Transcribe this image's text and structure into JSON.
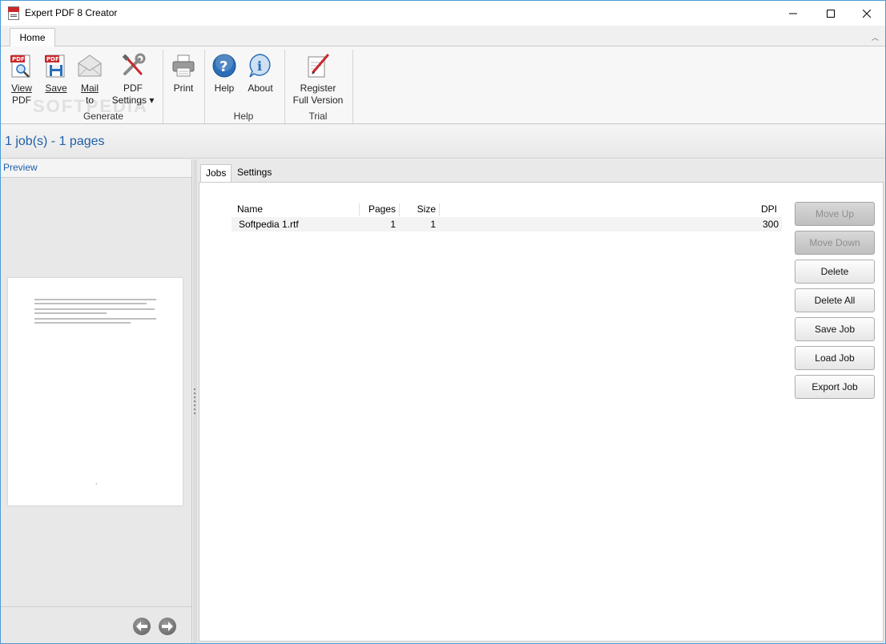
{
  "window": {
    "title": "Expert PDF 8 Creator"
  },
  "ribbon": {
    "tab_home": "Home",
    "buttons": {
      "view_pdf": [
        "View",
        "PDF"
      ],
      "save": "Save",
      "mail_to": [
        "Mail",
        "to"
      ],
      "pdf_settings": [
        "PDF",
        "Settings ▾"
      ],
      "print": "Print",
      "help": "Help",
      "about": "About",
      "register": [
        "Register",
        "Full Version"
      ]
    },
    "groups": {
      "generate": "Generate",
      "help": "Help",
      "trial": "Trial"
    },
    "watermark": "SOFTPEDIA"
  },
  "status": {
    "summary": "1 job(s) - 1 pages"
  },
  "preview": {
    "label": "Preview",
    "page_number": "1"
  },
  "jobs": {
    "tabs": {
      "jobs": "Jobs",
      "settings": "Settings"
    },
    "columns": {
      "name": "Name",
      "pages": "Pages",
      "size": "Size",
      "dpi": "DPI"
    },
    "rows": [
      {
        "name": "Softpedia 1.rtf",
        "pages": "1",
        "size": "1",
        "dpi": "300"
      }
    ],
    "buttons": {
      "move_up": "Move Up",
      "move_down": "Move Down",
      "delete": "Delete",
      "delete_all": "Delete All",
      "save_job": "Save Job",
      "load_job": "Load Job",
      "export_job": "Export Job"
    }
  },
  "colors": {
    "accent_blue": "#1f5fa8",
    "window_border": "#4d9bd6",
    "pdf_red": "#c8282d"
  },
  "icons": [
    "pdf-app-icon",
    "minimize-icon",
    "maximize-icon",
    "close-icon",
    "view-pdf-icon",
    "save-pdf-icon",
    "mail-icon",
    "tools-icon",
    "printer-icon",
    "help-icon",
    "info-icon",
    "register-icon",
    "arrow-left-icon",
    "arrow-right-icon"
  ]
}
